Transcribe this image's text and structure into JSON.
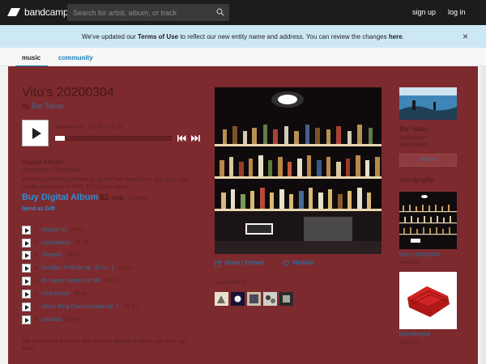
{
  "header": {
    "logo_text": "bandcamp",
    "search_placeholder": "Search for artist, album, or track",
    "signup": "sign up",
    "login": "log in"
  },
  "notice": {
    "before": "We've updated our ",
    "link1": "Terms of Use",
    "middle": " to reflect our new entity name and address. You can review the changes ",
    "link2": "here",
    "after": ".",
    "close": "×"
  },
  "tabs": {
    "music": "music",
    "community": "community"
  },
  "album": {
    "title": "Vito's 20200304",
    "by": "by ",
    "artist": "Bar Tabac",
    "now_playing_track": "cobrelencia",
    "now_playing_time": "00:00 / 02:35",
    "progress": 0
  },
  "digital": {
    "title": "Digital Album",
    "subtitle": "Streaming + Download",
    "description": "Includes unlimited streaming via the free Bandcamp app, plus high-quality download in MP3, FLAC and more.",
    "buy_label": "Buy Digital Album",
    "price": "$3",
    "currency": "USD",
    "or_more": "or more",
    "gift": "Send as Gift"
  },
  "tracks": [
    {
      "num": "1.",
      "name": "shangri la",
      "dur": "04:24"
    },
    {
      "num": "2.",
      "name": "cobrelencia",
      "dur": "02:35"
    },
    {
      "num": "3.",
      "name": "charade",
      "dur": "09:25"
    },
    {
      "num": "4.",
      "name": "Scriabin Prelude op. 31 no. 1",
      "dur": "02:22"
    },
    {
      "num": "5.",
      "name": "oh sweet mystery of life",
      "dur": "06:21"
    },
    {
      "num": "6.",
      "name": "c'est si bon",
      "dur": "05:41"
    },
    {
      "num": "7.",
      "name": "Alban Berg Piano Sonata op. 1",
      "dur": "04:30"
    },
    {
      "num": "8.",
      "name": "stardust",
      "dur": "03:44"
    }
  ],
  "about": "live recordings from the last time we played at vito's, one year ago today",
  "actions": {
    "share": "Share / Embed",
    "wishlist": "Wishlist"
  },
  "supported_by": "supported by",
  "band": {
    "name": "Bar Tabac",
    "location": "Bellingham, Washington",
    "follow": "Follow"
  },
  "discography": {
    "heading": "discography",
    "items": [
      {
        "title": "Vito's 20200304",
        "date": "Mar 2021"
      },
      {
        "title": "bistrotheque",
        "date": "Mar 2012"
      }
    ]
  },
  "colors": {
    "panel": "#7d2a2e",
    "link": "#2b6f9a",
    "accent": "#2b8fd6"
  }
}
